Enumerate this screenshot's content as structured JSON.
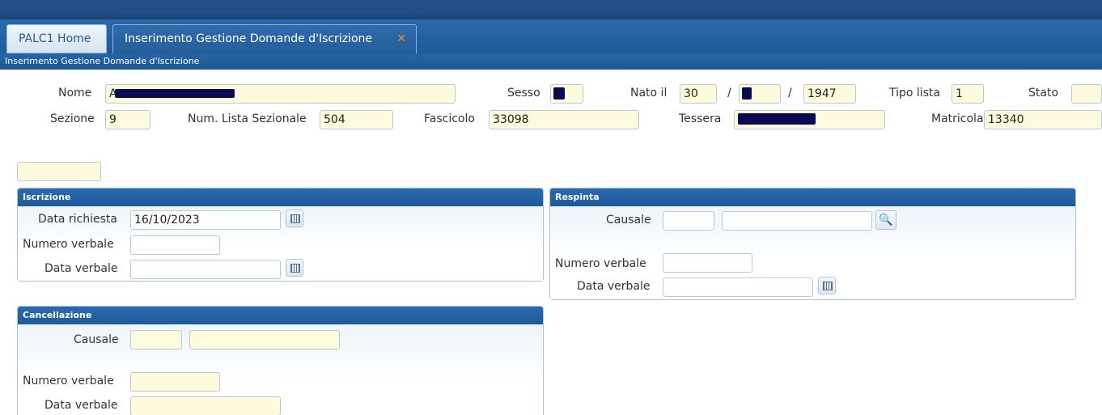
{
  "tabs": {
    "home": "PALC1 Home",
    "active": "Inserimento Gestione Domande d'Iscrizione",
    "close_glyph": "✕"
  },
  "page_subtitle": "Inserimento Gestione Domande d'Iscrizione",
  "header": {
    "nome_label": "Nome",
    "nome_value": "A",
    "sesso_label": "Sesso",
    "nato_label": "Nato il",
    "nato_day": "30",
    "nato_sep1": "/",
    "nato_sep2": "/",
    "nato_year": "1947",
    "tipo_lista_label": "Tipo lista",
    "tipo_lista_value": "1",
    "stato_label": "Stato",
    "stato_value": "",
    "sezione_label": "Sezione",
    "sezione_value": "9",
    "num_lista_label": "Num. Lista Sezionale",
    "num_lista_value": "504",
    "fascicolo_label": "Fascicolo",
    "fascicolo_value": "33098",
    "tessera_label": "Tessera",
    "matricola_label": "Matricola",
    "matricola_value": "13340"
  },
  "standalone_field_value": "",
  "iscrizione": {
    "title": "Iscrizione",
    "data_richiesta_label": "Data richiesta",
    "data_richiesta_value": "16/10/2023",
    "numero_verbale_label": "Numero verbale",
    "numero_verbale_value": "",
    "data_verbale_label": "Data verbale",
    "data_verbale_value": ""
  },
  "respinta": {
    "title": "Respinta",
    "causale_label": "Causale",
    "causale_code": "",
    "causale_desc": "",
    "numero_verbale_label": "Numero verbale",
    "numero_verbale_value": "",
    "data_verbale_label": "Data verbale",
    "data_verbale_value": ""
  },
  "cancellazione": {
    "title": "Cancellazione",
    "causale_label": "Causale",
    "causale_code": "",
    "causale_desc": "",
    "numero_verbale_label": "Numero verbale",
    "numero_verbale_value": "",
    "data_verbale_label": "Data verbale",
    "data_verbale_value": ""
  },
  "icons": {
    "calendar": "calendar-icon",
    "search": "search-icon"
  },
  "colors": {
    "header_blue": "#1f5a99",
    "field_yellow": "#fefbdc",
    "close_orange": "#f08a24",
    "redaction": "#0a0a52"
  }
}
